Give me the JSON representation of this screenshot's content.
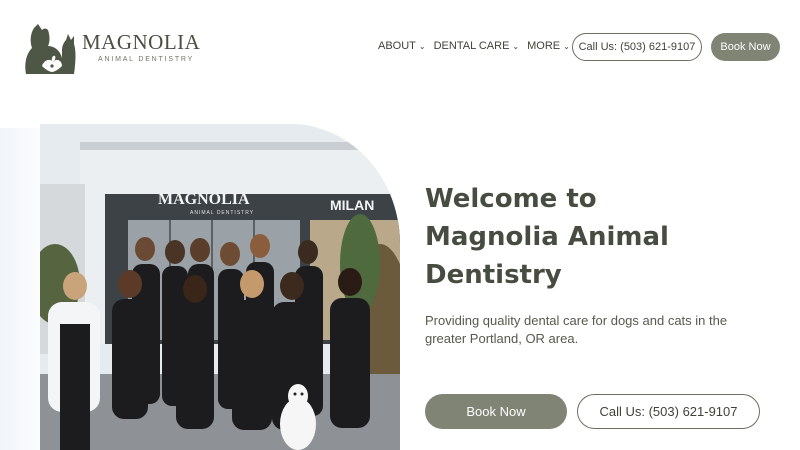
{
  "brand": {
    "name": "MAGNOLIA",
    "tagline": "ANIMAL DENTISTRY"
  },
  "nav": {
    "items": [
      {
        "label": "ABOUT",
        "icon": "chevron-down-icon"
      },
      {
        "label": "DENTAL CARE",
        "icon": "chevron-down-icon"
      },
      {
        "label": "MORE",
        "icon": "chevron-down-icon"
      }
    ],
    "call_label": "Call Us: (503) 621-9107",
    "book_label": "Book Now"
  },
  "hero": {
    "title_lines": [
      "Welcome to",
      "Magnolia Animal",
      "Dentistry"
    ],
    "description": "Providing quality dental care for dogs and cats in the greater Portland, OR area.",
    "book_label": "Book Now",
    "call_label": "Call Us: (503) 621-9107",
    "photo": {
      "sign_text": "MAGNOLIA",
      "sign_subtext": "ANIMAL DENTISTRY",
      "side_sign_text": "MILAN"
    }
  },
  "colors": {
    "primary_button": "#7f8474",
    "heading_text": "#474c40",
    "outline": "#6b7060"
  }
}
